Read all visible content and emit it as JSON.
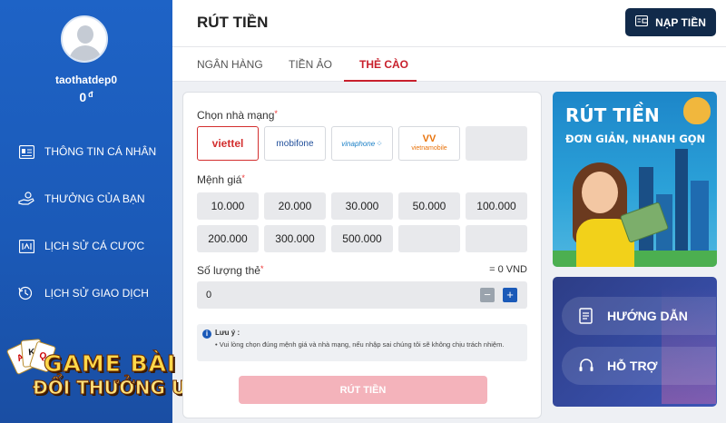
{
  "sidebar": {
    "username": "taothatdep0",
    "balance": "0",
    "currency": "đ",
    "items": [
      {
        "label": "THÔNG TIN CÁ NHÂN",
        "icon": "id-card-icon"
      },
      {
        "label": "THƯỞNG CỦA BẠN",
        "icon": "gift-hand-icon"
      },
      {
        "label": "LỊCH SỬ CÁ CƯỢC",
        "icon": "bet-history-icon"
      },
      {
        "label": "LỊCH SỬ GIAO DỊCH",
        "icon": "transaction-history-icon"
      }
    ],
    "logo": {
      "line1": "GAME BÀI",
      "line2": "ĐỔI THƯỞNG UK"
    }
  },
  "header": {
    "title": "RÚT TIỀN",
    "deposit_label": "NẠP TIỀN"
  },
  "tabs": [
    {
      "label": "NGÂN HÀNG"
    },
    {
      "label": "TIỀN ẢO"
    },
    {
      "label": "THẺ CÀO",
      "active": true
    }
  ],
  "form": {
    "carrier_label": "Chọn nhà mạng",
    "carriers": [
      {
        "name": "viettel",
        "color": "#d32f2f",
        "selected": true
      },
      {
        "name": "mobifone",
        "color": "#1f4e9a"
      },
      {
        "name": "vinaphone",
        "color": "#1a7fc6"
      },
      {
        "name": "vietnamobile",
        "color": "#e8730c"
      }
    ],
    "amount_label": "Mệnh giá",
    "amounts": [
      "10.000",
      "20.000",
      "30.000",
      "50.000",
      "100.000",
      "200.000",
      "300.000",
      "500.000"
    ],
    "quantity_label": "Số lượng thẻ",
    "total": "= 0 VND",
    "quantity_value": "0",
    "minus": "−",
    "plus": "+",
    "note_title": "Lưu ý :",
    "note_text": "Vui lòng chọn đúng mệnh giá và nhà mạng, nếu nhập sai chúng tôi sẽ không chịu trách nhiệm.",
    "submit_label": "RÚT TIỀN"
  },
  "promo": {
    "title": "RÚT TIỀN",
    "subtitle": "ĐƠN GIẢN, NHANH GỌN"
  },
  "help": {
    "guide_label": "HƯỚNG DẪN",
    "support_label": "HỖ TRỢ"
  },
  "colors": {
    "sidebar": "#1e63c6",
    "accent": "#c8202c",
    "dark_button": "#112a4a",
    "submit_disabled": "#f4b3bb"
  }
}
